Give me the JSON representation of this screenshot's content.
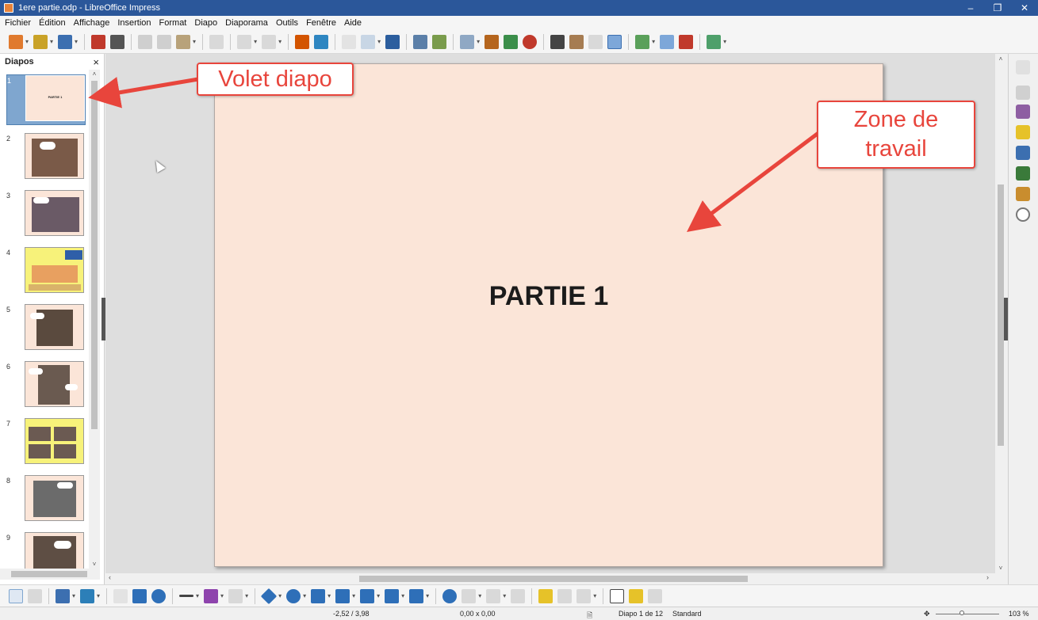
{
  "window": {
    "title": "1ere partie.odp - LibreOffice Impress",
    "minimize": "–",
    "maximize": "❐",
    "close": "✕"
  },
  "menu": [
    "Fichier",
    "Édition",
    "Affichage",
    "Insertion",
    "Format",
    "Diapo",
    "Diaporama",
    "Outils",
    "Fenêtre",
    "Aide"
  ],
  "slide_pane": {
    "title": "Diapos",
    "close": "×",
    "slides": [
      {
        "num": "1",
        "title": "PARTIE 1"
      },
      {
        "num": "2"
      },
      {
        "num": "3"
      },
      {
        "num": "4"
      },
      {
        "num": "5"
      },
      {
        "num": "6"
      },
      {
        "num": "7"
      },
      {
        "num": "8"
      },
      {
        "num": "9"
      }
    ]
  },
  "slide": {
    "title": "PARTIE 1"
  },
  "annotations": {
    "volet": "Volet diapo",
    "zone_line1": "Zone de",
    "zone_line2": "travail"
  },
  "status": {
    "position": "-2,52 / 3,98",
    "size": "0,00 x 0,00",
    "slide_info": "Diapo 1 de 12",
    "master": "Standard",
    "zoom": "103 %"
  },
  "colors": {
    "titlebar": "#2b579a",
    "slide_bg": "#fbe5d8",
    "annotation": "#e8453c"
  }
}
